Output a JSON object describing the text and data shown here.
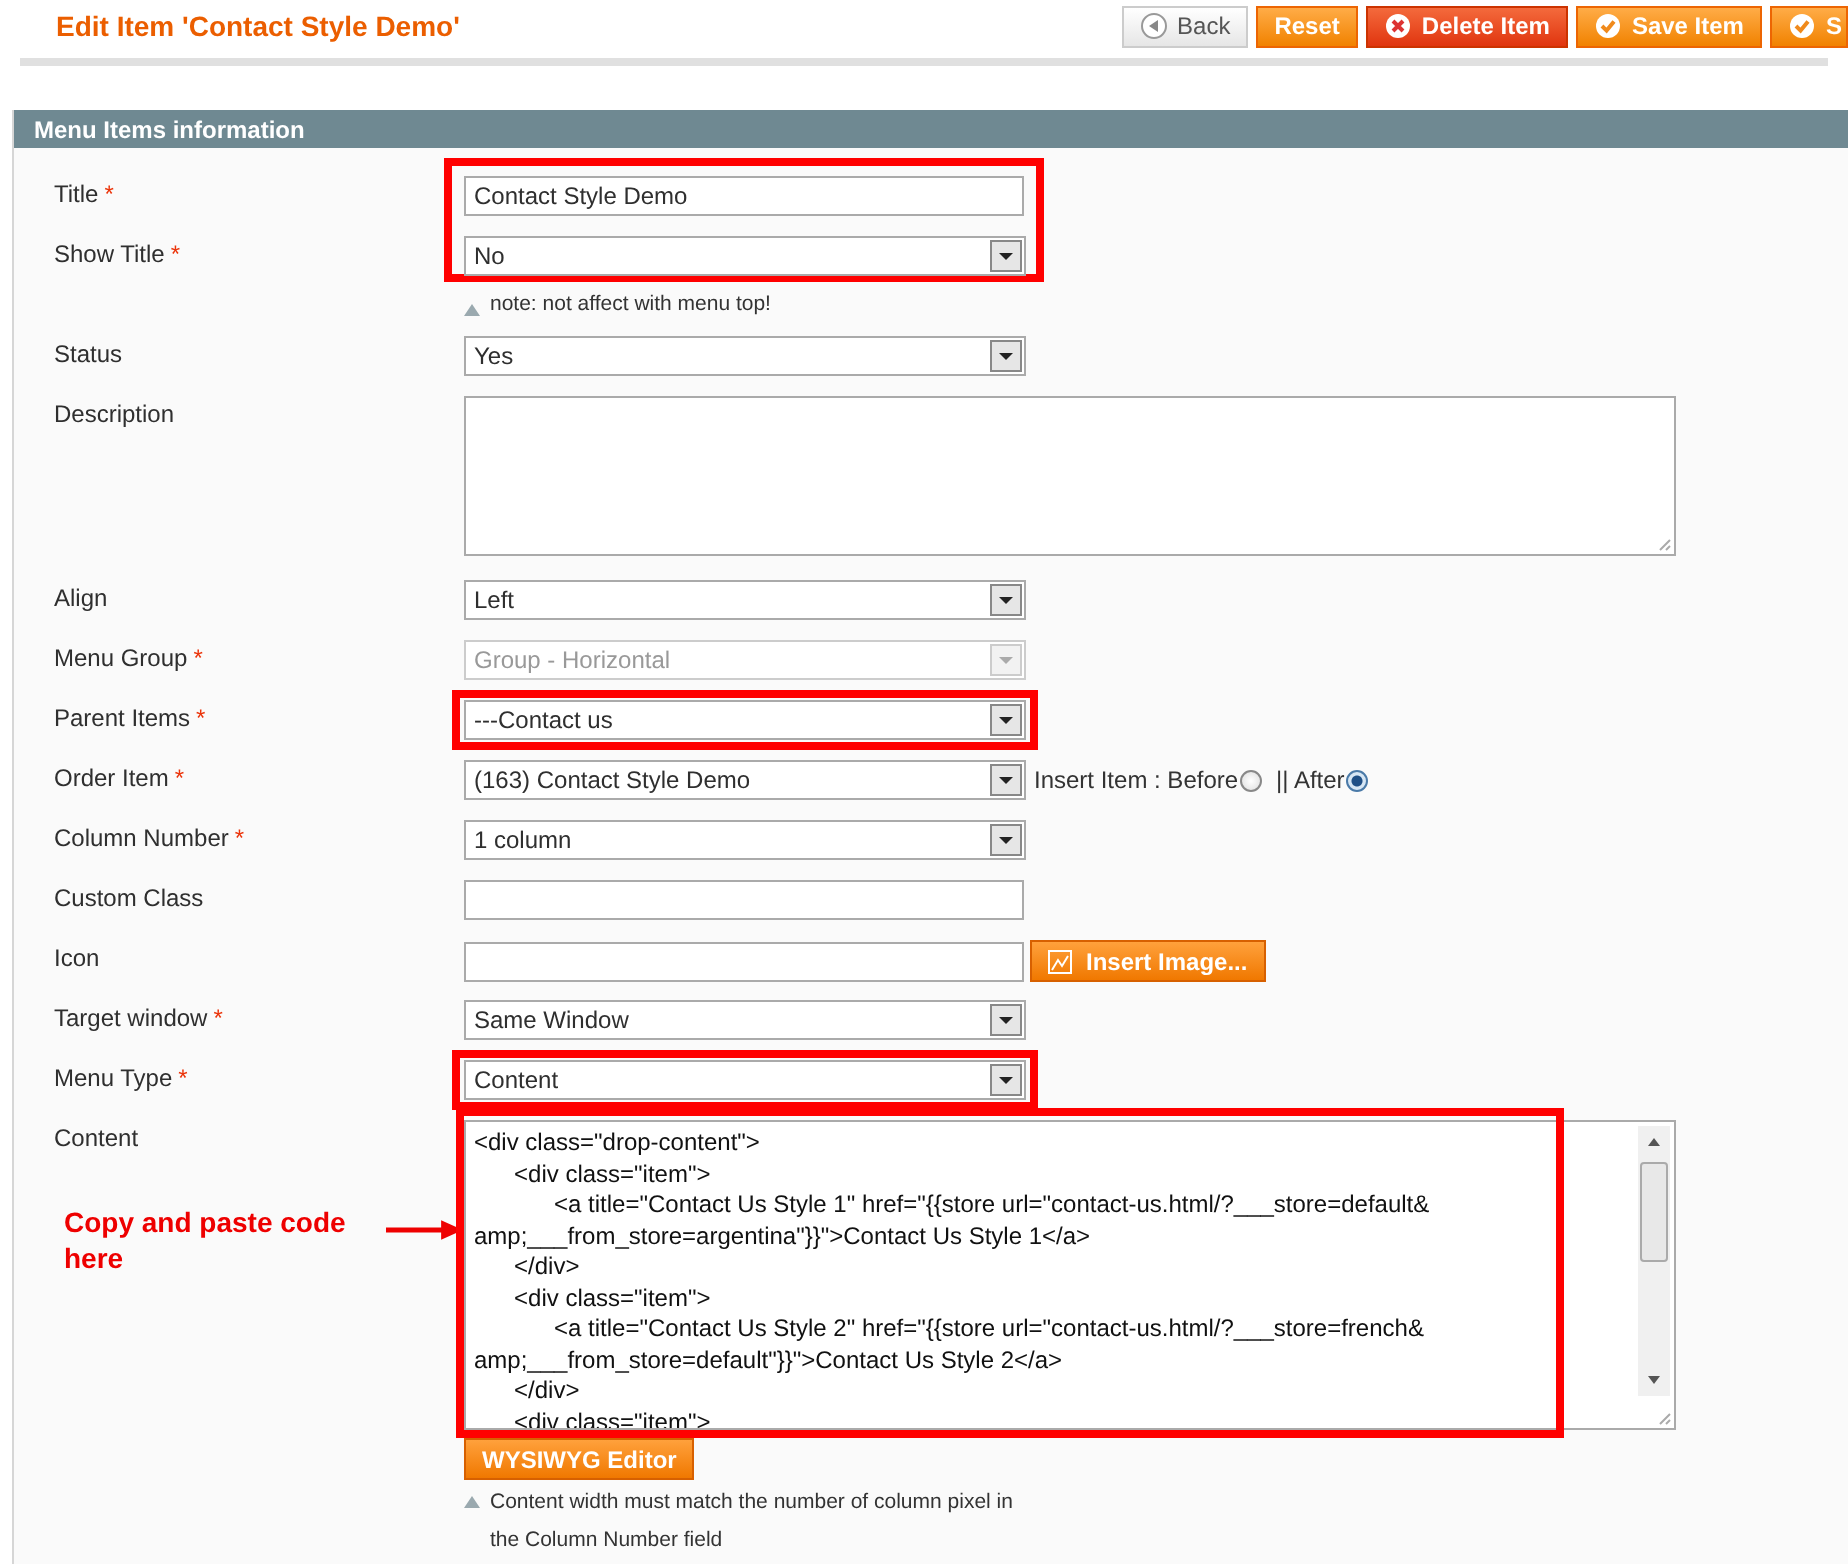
{
  "header": {
    "title": "Edit Item 'Contact Style Demo'",
    "buttons": [
      {
        "label": "Back",
        "kind": "back"
      },
      {
        "label": "Reset",
        "kind": "plain"
      },
      {
        "label": "Delete Item",
        "kind": "delete"
      },
      {
        "label": "Save Item",
        "kind": "save"
      },
      {
        "label": "S",
        "kind": "save"
      }
    ]
  },
  "section": {
    "title": "Menu Items information"
  },
  "blocks": [
    {
      "highlighted": true,
      "rows": [
        {
          "label": "Title",
          "mark": "*",
          "kind": "text",
          "value": "Contact Style Demo"
        },
        {
          "label": "Show Title",
          "mark": "*",
          "kind": "select",
          "value": "No"
        }
      ],
      "note": "note: not affect with menu top!"
    },
    {
      "highlighted": false,
      "rows": [
        {
          "label": "Status",
          "kind": "select",
          "value": "Yes"
        }
      ]
    },
    {
      "highlighted": false,
      "rows": [
        {
          "label": "Description",
          "kind": "textarea"
        }
      ]
    },
    {
      "highlighted": false,
      "rows": [
        {
          "label": "Align",
          "kind": "select",
          "value": "Left"
        },
        {
          "label": "Menu Group",
          "mark": "*",
          "kind": "select",
          "value": "Group - Horizontal",
          "disabled": true
        }
      ]
    },
    {
      "highlighted": true,
      "rows": [
        {
          "label": "Parent Items",
          "mark": "*",
          "kind": "select",
          "value": "---Contact us"
        }
      ]
    },
    {
      "highlighted": false,
      "rows": [
        {
          "label": "Order Item",
          "mark": "*",
          "kind": "select",
          "value": "(163) Contact Style Demo",
          "radios": [
            {
              "label": "Insert Item : Before",
              "selected": false
            },
            {
              "label": "|| After",
              "selected": true
            }
          ]
        },
        {
          "label": "Column Number",
          "mark": "*",
          "kind": "select",
          "value": "1 column"
        },
        {
          "label": "Custom Class",
          "kind": "text"
        },
        {
          "label": "Icon",
          "kind": "text",
          "button": "Insert Image..."
        },
        {
          "label": "Target window",
          "mark": "*",
          "kind": "select",
          "value": "Same Window"
        }
      ]
    },
    {
      "highlighted": true,
      "rows": [
        {
          "label": "Menu Type",
          "mark": "*",
          "kind": "select",
          "value": "Content"
        }
      ]
    },
    {
      "highlighted": true,
      "rows": [
        {
          "label": "Content",
          "kind": "code",
          "annotation": "Copy and paste code here",
          "button": "WYSIWYG Editor",
          "note": "Content width must match the number of column pixel in the Column Number field",
          "lines": [
            "<div class=\"drop-content\">",
            "\t<div class=\"item\">",
            "\t\t<a title=\"Contact Us Style 1\" href=\"{{store url=\"contact-us.html/?___store=default&",
            "amp;___from_store=argentina\"}}\">Contact Us Style 1</a>",
            "\t</div>",
            "\t<div class=\"item\">",
            "\t\t<a title=\"Contact Us Style 2\" href=\"{{store url=\"contact-us.html/?___store=french&",
            "amp;___from_store=default\"}}\">Contact Us Style 2</a>",
            "\t</div>",
            "\t<div class=\"item\">"
          ]
        }
      ]
    }
  ]
}
